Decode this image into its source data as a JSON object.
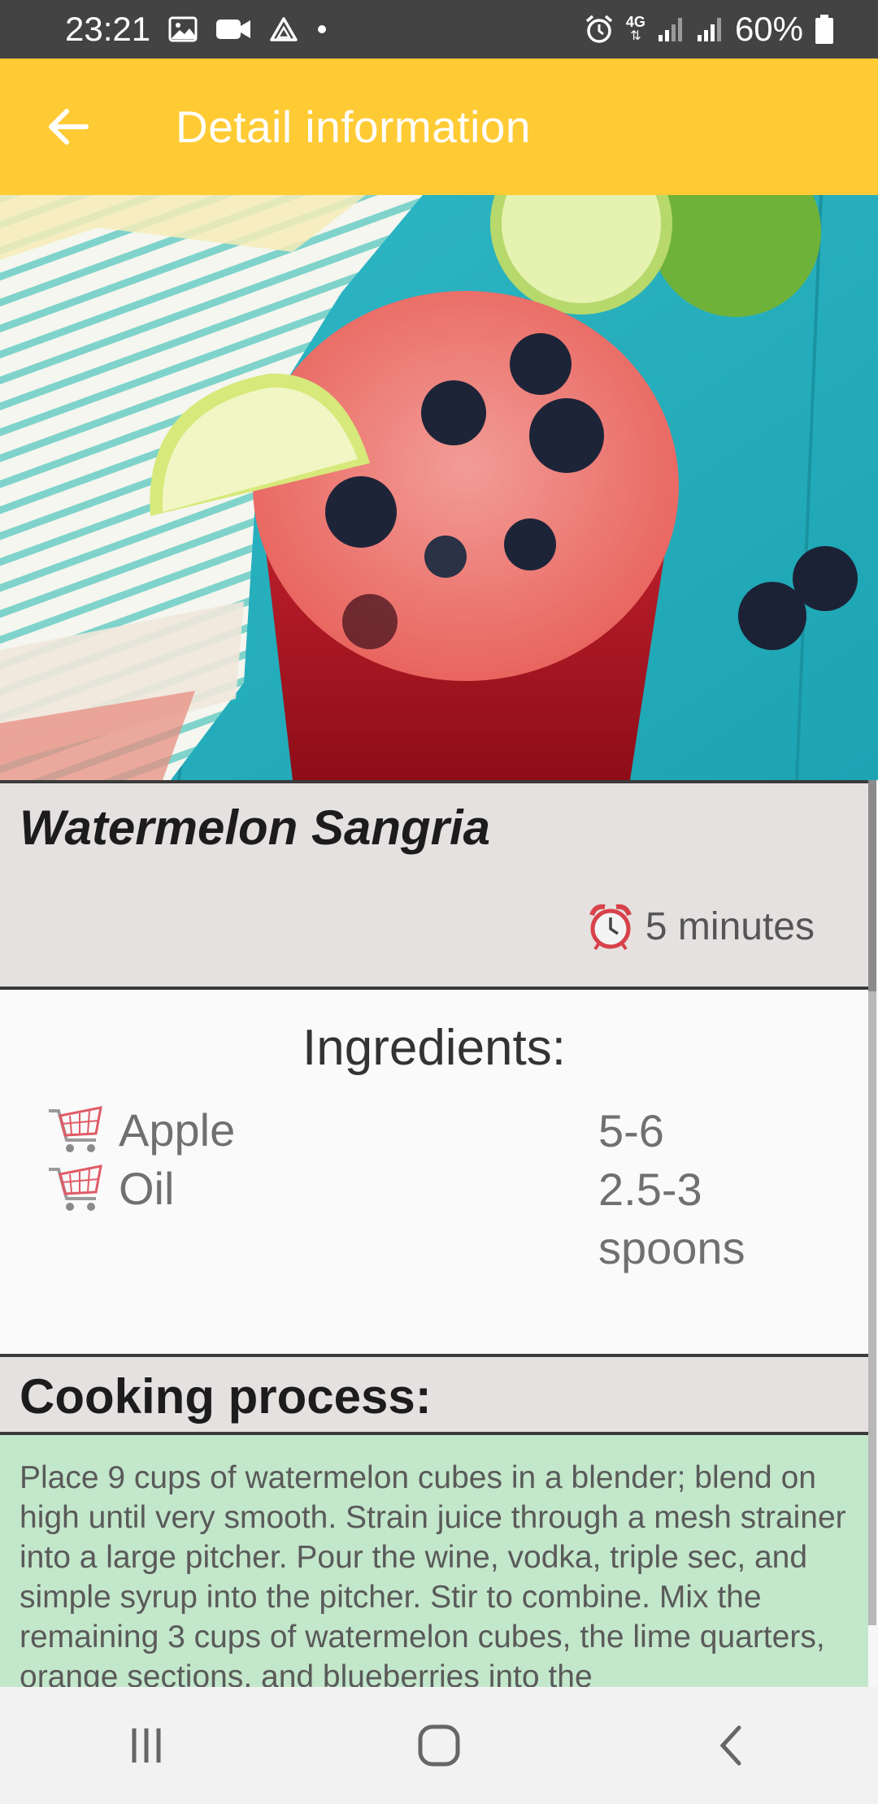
{
  "status_bar": {
    "time": "23:21",
    "network": "4G",
    "battery": "60%",
    "icons": [
      "gallery-icon",
      "video-icon",
      "drive-icon",
      "dot-icon",
      "alarm-icon",
      "signal-icon",
      "battery-icon"
    ]
  },
  "app_bar": {
    "title": "Detail information",
    "back_icon": "arrow-left-icon",
    "background": "#ffcb35"
  },
  "recipe": {
    "title": "Watermelon Sangria",
    "time": "5 minutes",
    "time_icon": "alarm-clock-icon"
  },
  "ingredients": {
    "heading": "Ingredients:",
    "items": [
      {
        "name": "Apple",
        "quantity_lines": [
          "5-6"
        ],
        "icon": "cart-icon"
      },
      {
        "name": "Oil",
        "quantity_lines": [
          "2.5-3",
          "spoons"
        ],
        "icon": "cart-icon"
      }
    ]
  },
  "cooking": {
    "heading": "Cooking process:",
    "text": "Place 9 cups of watermelon cubes in a blender; blend on high until very smooth. Strain juice through a mesh strainer into a large pitcher. Pour the wine, vodka, triple sec, and simple syrup into the pitcher. Stir to combine. Mix the remaining 3 cups of watermelon cubes, the lime quarters, orange sections, and blueberries into the"
  },
  "nav_bar": {
    "icons": [
      "recent-apps-icon",
      "home-icon",
      "back-icon"
    ]
  },
  "colors": {
    "status_bar": "#434343",
    "section_bg": "#e6e1e1",
    "process_bg": "#c3e7cb"
  }
}
